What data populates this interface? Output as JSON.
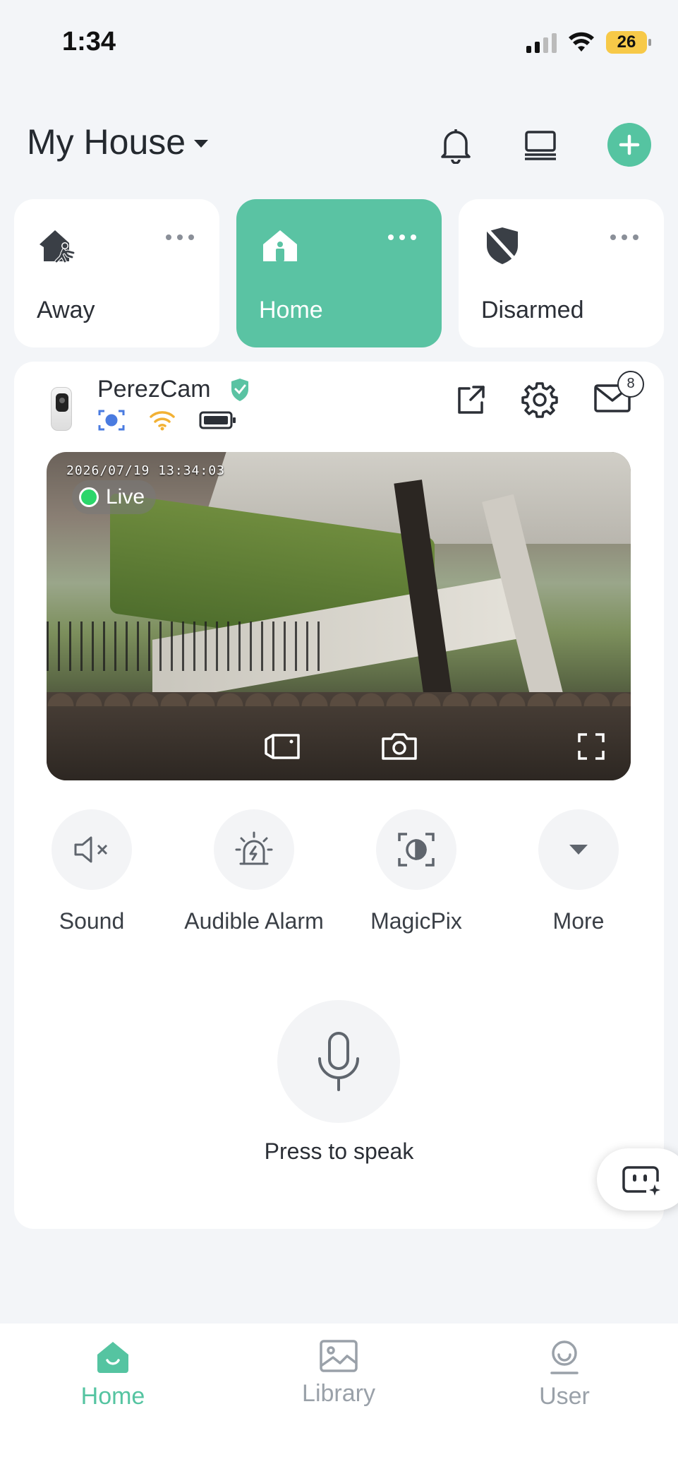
{
  "status_bar": {
    "time": "1:34",
    "battery": "26"
  },
  "header": {
    "house_name": "My House"
  },
  "modes": [
    {
      "label": "Away",
      "icon": "away-house-icon",
      "active": false
    },
    {
      "label": "Home",
      "icon": "home-house-icon",
      "active": true
    },
    {
      "label": "Disarmed",
      "icon": "disarmed-shield-icon",
      "active": false
    }
  ],
  "camera": {
    "name": "PerezCam",
    "timestamp": "2026/07/19 13:34:03",
    "live_label": "Live",
    "message_count": "8"
  },
  "controls": [
    {
      "label": "Sound",
      "icon": "sound-muted-icon"
    },
    {
      "label": "Audible Alarm",
      "icon": "alarm-icon"
    },
    {
      "label": "MagicPix",
      "icon": "magicpix-icon"
    },
    {
      "label": "More",
      "icon": "chevron-down-icon"
    }
  ],
  "speak": {
    "label": "Press to speak"
  },
  "nav": [
    {
      "label": "Home",
      "active": true
    },
    {
      "label": "Library",
      "active": false
    },
    {
      "label": "User",
      "active": false
    }
  ],
  "colors": {
    "accent": "#55c4a1",
    "active_card": "#5ac3a3",
    "battery": "#f7c948",
    "live": "#2bd66a"
  }
}
